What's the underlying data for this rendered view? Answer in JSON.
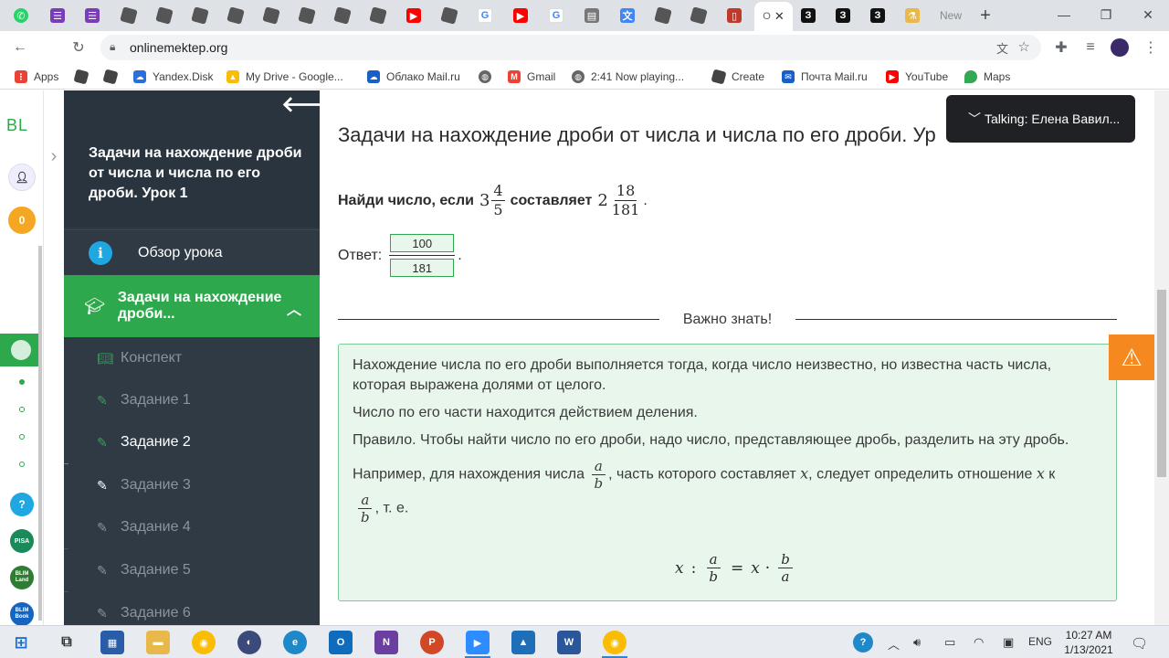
{
  "browser": {
    "url": "onlinemektep.org",
    "active_tab_initial": "О",
    "tab_icons": [
      "whatsapp-icon",
      "onenote-icon",
      "onenote-icon",
      "roblox-icon",
      "roblox-icon",
      "roblox-icon",
      "roblox-icon",
      "roblox-icon",
      "roblox-icon",
      "roblox-icon",
      "roblox-icon",
      "youtube-icon",
      "roblox-icon",
      "google-icon",
      "youtube-icon",
      "google-icon",
      "sheets-icon",
      "translate-icon",
      "roblox-icon",
      "roblox-icon",
      "docs-icon"
    ],
    "tab_badges": {
      "t1": "З",
      "t2": "З",
      "t3": "З"
    },
    "new_tab_label": "New"
  },
  "bookmarks": [
    {
      "label": "Apps",
      "icon": "apps-icon"
    },
    {
      "label": "",
      "icon": "roblox-icon"
    },
    {
      "label": "",
      "icon": "roblox-icon"
    },
    {
      "label": "Yandex.Disk",
      "icon": "yandex-disk-icon"
    },
    {
      "label": "My Drive - Google...",
      "icon": "google-drive-icon"
    },
    {
      "label": "Облако Mail.ru",
      "icon": "mailru-cloud-icon"
    },
    {
      "label": "",
      "icon": "globe-icon"
    },
    {
      "label": "Gmail",
      "icon": "gmail-icon"
    },
    {
      "label": "2:41 Now playing...",
      "icon": "globe-icon"
    },
    {
      "label": "Create",
      "icon": "roblox-icon"
    },
    {
      "label": "Почта Mail.ru",
      "icon": "mailru-icon"
    },
    {
      "label": "YouTube",
      "icon": "youtube-icon"
    },
    {
      "label": "Maps",
      "icon": "maps-icon"
    }
  ],
  "rail": {
    "brand": "BL",
    "coins": "0",
    "help": "?",
    "apps": [
      "PISA",
      "BLIM Land",
      "BLIM Book"
    ]
  },
  "sidebar": {
    "title": "Задачи на нахождение дроби от числа и числа по его дроби. Урок 1",
    "overview": "Обзор урока",
    "section": "Задачи на нахождение дроби...",
    "items": [
      {
        "label": "Конспект",
        "state": "done"
      },
      {
        "label": "Задание 1",
        "state": "done"
      },
      {
        "label": "Задание 2",
        "state": "current"
      },
      {
        "label": "Задание 3",
        "state": "todo"
      },
      {
        "label": "Задание 4",
        "state": "todo"
      },
      {
        "label": "Задание 5",
        "state": "todo"
      },
      {
        "label": "Задание 6",
        "state": "todo"
      }
    ]
  },
  "main": {
    "lesson_title": "Задачи на нахождение дроби от числа и числа по его дроби. Ур",
    "task": {
      "prefix": "Найди число, если",
      "mixed1": {
        "whole": "3",
        "num": "4",
        "den": "5"
      },
      "middle": "составляет",
      "mixed2": {
        "whole": "2",
        "num": "18",
        "den": "181"
      },
      "suffix": "."
    },
    "answer": {
      "label": "Ответ:",
      "numerator": "100",
      "denominator": "181",
      "suffix": "."
    },
    "important_heading": "Важно знать!",
    "info": {
      "p1": "Нахождение числа по его дроби выполняется тогда, когда число неизвестно, но известна часть числа, которая выражена долями от целого.",
      "p2": "Число по его части находится действием деления.",
      "p3": "Правило. Чтобы найти число по его дроби, надо число, представляющее дробь, разделить на эту дробь.",
      "p4_a": "Например, для нахождения числа",
      "p4_b": ", часть которого составляет",
      "p4_c": ", следует определить отношение",
      "p4_d": "к",
      "p4_e": ", т. е.",
      "var_a": "a",
      "var_b": "b",
      "var_x": "x"
    },
    "formula": {
      "x": "x",
      "colon": ":",
      "eq": "=",
      "dot": "·",
      "a": "a",
      "b": "b"
    }
  },
  "talking": {
    "label": "Talking: Елена Вавил..."
  },
  "taskbar": {
    "time": "10:27 AM",
    "date": "1/13/2021",
    "lang": "ENG"
  },
  "colors": {
    "accent_green": "#2ea84d",
    "sidebar_bg": "#2f3a45",
    "info_bg": "#e9f6ec",
    "warning_orange": "#f5891f"
  }
}
